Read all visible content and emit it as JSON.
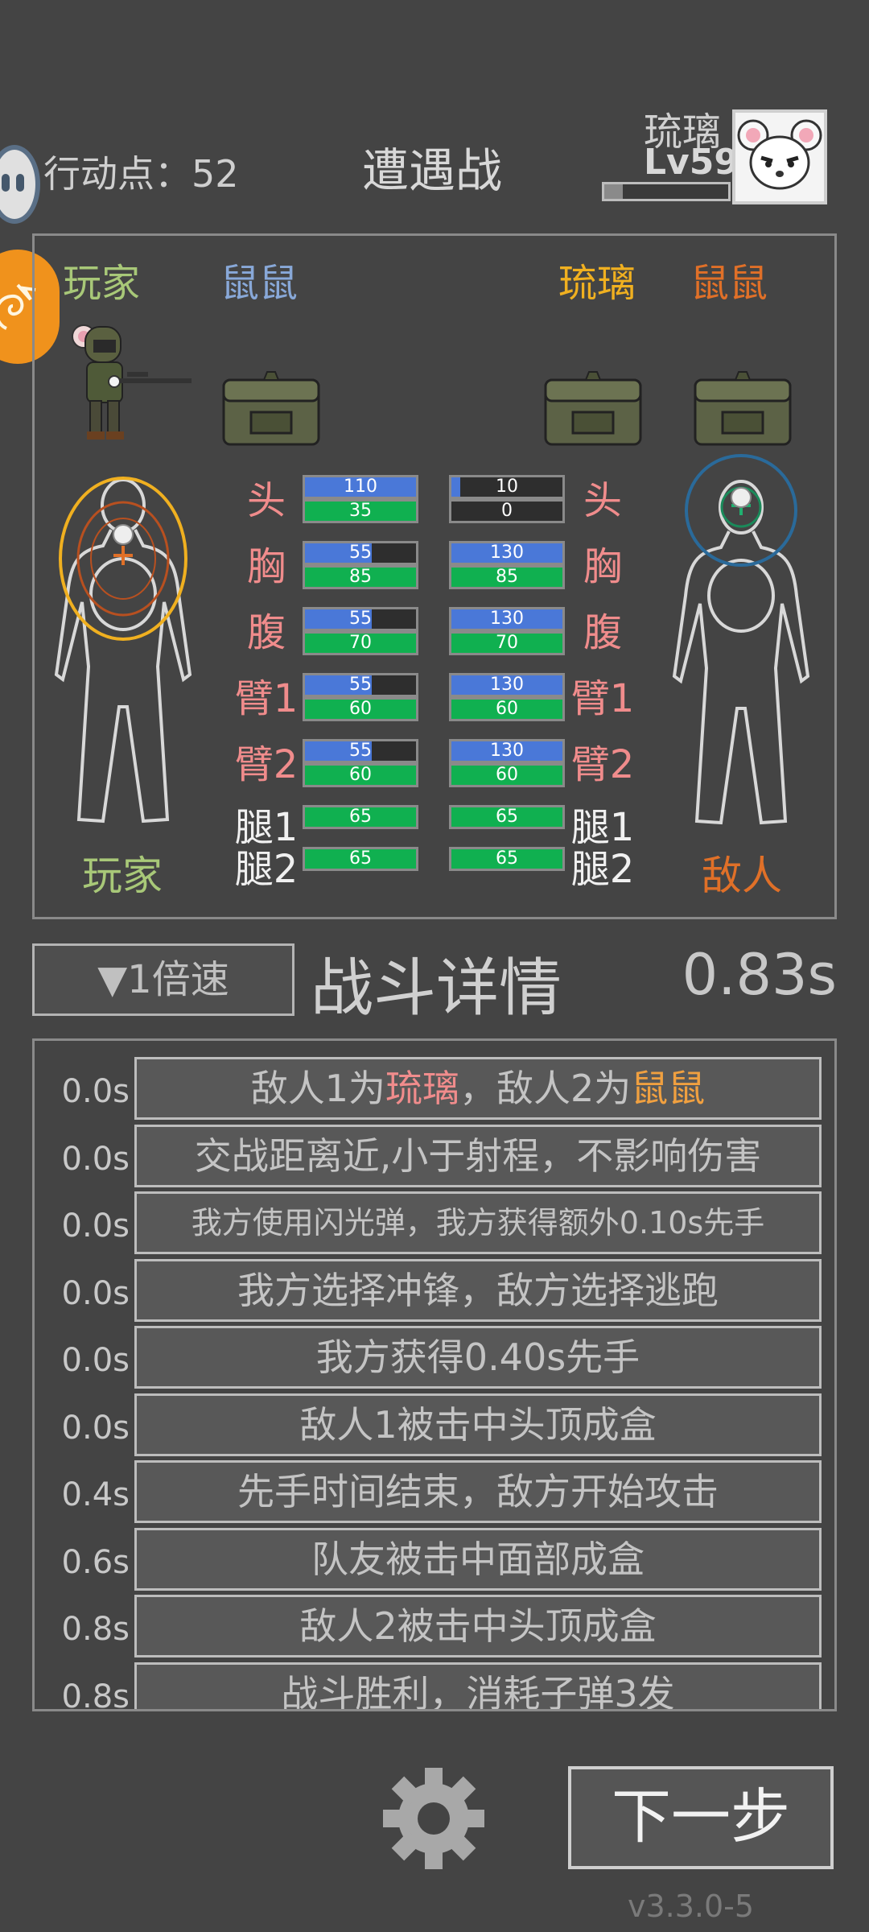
{
  "header": {
    "action_points": "行动点：52",
    "title": "遭遇战",
    "player_name": "琉璃",
    "player_level": "Lv59",
    "xp_fraction": 0.15
  },
  "battle": {
    "team_left_1": "玩家",
    "team_left_2": "鼠鼠",
    "team_right_1": "琉璃",
    "team_right_2": "鼠鼠",
    "bottom_left": "玩家",
    "bottom_right": "敌人",
    "colors": {
      "left_1": "#a8c878",
      "left_2": "#88a8d8",
      "right_1": "#f0b020",
      "right_2": "#e07028",
      "part_red": "#f08c8c",
      "part_white": "#f0f0f0"
    },
    "parts": [
      {
        "label": "头",
        "left_armor": 110,
        "left_armor_fill": 1.0,
        "left_hp": 35,
        "left_hp_fill": 1.0,
        "right_armor": 10,
        "right_armor_fill": 0.08,
        "right_hp": 0,
        "right_hp_fill": 0,
        "color": "red"
      },
      {
        "label": "胸",
        "left_armor": 55,
        "left_armor_fill": 0.6,
        "left_hp": 85,
        "left_hp_fill": 1.0,
        "right_armor": 130,
        "right_armor_fill": 1.0,
        "right_hp": 85,
        "right_hp_fill": 1.0,
        "color": "red"
      },
      {
        "label": "腹",
        "left_armor": 55,
        "left_armor_fill": 0.6,
        "left_hp": 70,
        "left_hp_fill": 1.0,
        "right_armor": 130,
        "right_armor_fill": 1.0,
        "right_hp": 70,
        "right_hp_fill": 1.0,
        "color": "red"
      },
      {
        "label": "臂1",
        "left_armor": 55,
        "left_armor_fill": 0.6,
        "left_hp": 60,
        "left_hp_fill": 1.0,
        "right_armor": 130,
        "right_armor_fill": 1.0,
        "right_hp": 60,
        "right_hp_fill": 1.0,
        "color": "red"
      },
      {
        "label": "臂2",
        "left_armor": 55,
        "left_armor_fill": 0.6,
        "left_hp": 60,
        "left_hp_fill": 1.0,
        "right_armor": 130,
        "right_armor_fill": 1.0,
        "right_hp": 60,
        "right_hp_fill": 1.0,
        "color": "red"
      },
      {
        "label": "腿1",
        "left_hp": 65,
        "left_hp_fill": 1.0,
        "right_hp": 65,
        "right_hp_fill": 1.0,
        "color": "white"
      },
      {
        "label": "腿2",
        "left_hp": 65,
        "left_hp_fill": 1.0,
        "right_hp": 65,
        "right_hp_fill": 1.0,
        "color": "white"
      }
    ]
  },
  "controls": {
    "speed_label": "▼1倍速",
    "details_title": "战斗详情",
    "timer": "0.83s"
  },
  "log": [
    {
      "time": "0.0s",
      "parts": [
        {
          "t": "敌人1为"
        },
        {
          "t": "琉璃",
          "c": "red"
        },
        {
          "t": "，敌人2为"
        },
        {
          "t": "鼠鼠",
          "c": "orange"
        }
      ]
    },
    {
      "time": "0.0s",
      "parts": [
        {
          "t": "交战距离近,小于射程，不影响伤害"
        }
      ]
    },
    {
      "time": "0.0s",
      "parts": [
        {
          "t": "我方使用闪光弹，我方获得额外0.10s先手"
        }
      ],
      "small": true
    },
    {
      "time": "0.0s",
      "parts": [
        {
          "t": "我方选择冲锋，敌方选择逃跑"
        }
      ]
    },
    {
      "time": "0.0s",
      "parts": [
        {
          "t": "我方获得0.40s先手"
        }
      ]
    },
    {
      "time": "0.0s",
      "parts": [
        {
          "t": "敌人1被击中头顶成盒"
        }
      ]
    },
    {
      "time": "0.4s",
      "parts": [
        {
          "t": "先手时间结束，敌方开始攻击"
        }
      ]
    },
    {
      "time": "0.6s",
      "parts": [
        {
          "t": "队友被击中面部成盒"
        }
      ]
    },
    {
      "time": "0.8s",
      "parts": [
        {
          "t": "敌人2被击中头顶成盒"
        }
      ]
    },
    {
      "time": "0.8s",
      "parts": [
        {
          "t": "战斗胜利，消耗子弹3发"
        }
      ]
    }
  ],
  "footer": {
    "next_label": "下一步",
    "version": "v3.3.0-5",
    "settings_icon": "gear-icon"
  }
}
